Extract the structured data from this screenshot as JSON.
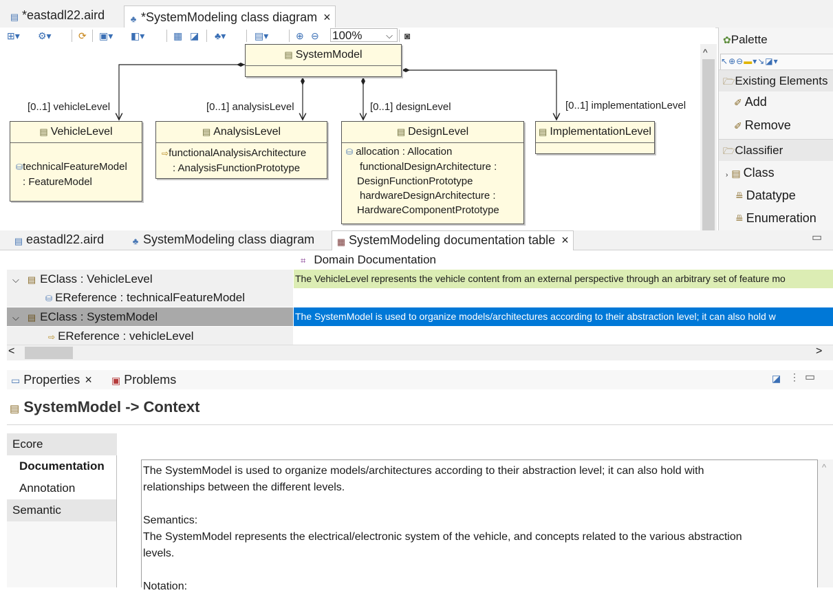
{
  "top_tabs": [
    {
      "label": "*eastadl22.aird",
      "icon": "aird-file-icon",
      "closable": false
    },
    {
      "label": "*SystemModeling class diagram",
      "icon": "class-diagram-icon",
      "closable": true
    }
  ],
  "close_glyph": "×",
  "toolbar": {
    "zoom_value": "100%",
    "zoom_in": "⊕",
    "zoom_out": "⊖"
  },
  "diagram": {
    "nodes": {
      "system_model": {
        "name": "SystemModel"
      },
      "vehicle_level": {
        "name": "VehicleLevel",
        "attrs": [
          "technicalFeatureModel",
          ": FeatureModel"
        ]
      },
      "analysis_level": {
        "name": "AnalysisLevel",
        "attrs": [
          "functionalAnalysisArchitecture",
          ": AnalysisFunctionPrototype"
        ]
      },
      "design_level": {
        "name": "DesignLevel",
        "attrs": [
          "allocation : Allocation",
          "functionalDesignArchitecture :",
          "DesignFunctionPrototype",
          "hardwareDesignArchitecture :",
          "HardwareComponentPrototype"
        ]
      },
      "implementation_level": {
        "name": "ImplementationLevel"
      }
    },
    "edges": [
      "[0..1] vehicleLevel",
      "[0..1] analysisLevel",
      "[0..1] designLevel",
      "[0..1] implementationLevel"
    ]
  },
  "palette": {
    "title": "Palette",
    "groups": [
      {
        "label": "Existing Elements",
        "items": [
          "Add",
          "Remove"
        ]
      },
      {
        "label": "Classifier",
        "items": [
          "Class",
          "Datatype",
          "Enumeration"
        ]
      }
    ]
  },
  "mid_tabs": [
    {
      "label": "eastadl22.aird",
      "icon": "aird-file-icon",
      "closable": false
    },
    {
      "label": "SystemModeling class diagram",
      "icon": "class-diagram-icon",
      "closable": false
    },
    {
      "label": "SystemModeling documentation table",
      "icon": "table-icon",
      "closable": true
    }
  ],
  "table": {
    "column_header": "Domain Documentation",
    "rows": [
      {
        "label": "EClass : VehicleLevel",
        "doc": "The VehicleLevel represents the vehicle content from an external perspective through an arbitrary set of feature mo",
        "state": "normal"
      },
      {
        "label": "EReference : technicalFeatureModel",
        "doc": "",
        "state": "normal"
      },
      {
        "label": "EClass : SystemModel",
        "doc": "The SystemModel is used to organize models/architectures according to their abstraction level; it can also hold w",
        "state": "selected"
      },
      {
        "label": "EReference : vehicleLevel",
        "doc": "",
        "state": "normal"
      }
    ]
  },
  "props_tabs": [
    {
      "label": "Properties",
      "closable": true
    },
    {
      "label": "Problems",
      "closable": false
    }
  ],
  "properties": {
    "title": "SystemModel -> Context",
    "side_tabs": [
      "Ecore",
      "Documentation",
      "Annotation",
      "Semantic"
    ],
    "doc_lines": [
      "The SystemModel is used to organize models/architectures according to their abstraction level; it can also hold with",
      "relationships between the different levels.",
      "",
      "Semantics:",
      "The SystemModel represents the electrical/electronic system of the vehicle, and concepts related to the various abstraction",
      "levels.",
      "",
      "Notation:"
    ]
  },
  "colors": {
    "selected_row": "#0078d7",
    "doc_highlight": "#dcedb4",
    "node_fill": "#fffbe0"
  }
}
